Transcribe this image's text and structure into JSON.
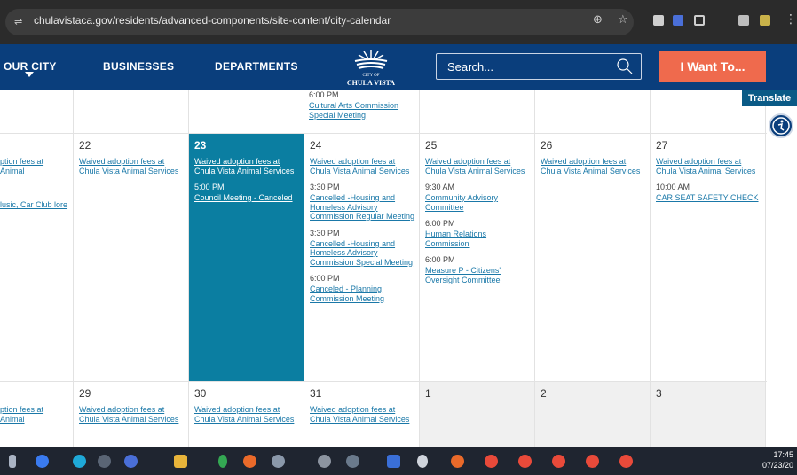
{
  "browser": {
    "url": "chulavistaca.gov/residents/advanced-components/site-content/city-calendar"
  },
  "header": {
    "nav": [
      "OUR CITY",
      "BUSINESSES",
      "DEPARTMENTS"
    ],
    "logo_line1": "CITY OF",
    "logo_line2": "CHULA VISTA",
    "search_placeholder": "Search...",
    "cta": "I Want To..."
  },
  "translate": "Translate",
  "calendar": {
    "prev_row_event": {
      "time": "6:00 PM",
      "title": "Cultural Arts Commission Special Meeting"
    },
    "week1": [
      {
        "day": "",
        "events": [
          {
            "title": "ption fees at Animal"
          },
          {
            "title": "lusic, Car Club lore"
          }
        ]
      },
      {
        "day": "22",
        "events": [
          {
            "title": "Waived adoption fees at Chula Vista Animal Services"
          }
        ]
      },
      {
        "day": "23",
        "events": [
          {
            "title": "Waived adoption fees at Chula Vista Animal Services"
          },
          {
            "time": "5:00 PM",
            "title": "Council Meeting - Canceled"
          }
        ]
      },
      {
        "day": "24",
        "events": [
          {
            "title": "Waived adoption fees at Chula Vista Animal Services"
          },
          {
            "time": "3:30 PM",
            "title": "Cancelled -Housing and Homeless Advisory Commission Regular Meeting"
          },
          {
            "time": "3:30 PM",
            "title": "Cancelled -Housing and Homeless Advisory Commission Special Meeting"
          },
          {
            "time": "6:00 PM",
            "title": "Canceled - Planning Commission Meeting"
          }
        ]
      },
      {
        "day": "25",
        "events": [
          {
            "title": "Waived adoption fees at Chula Vista Animal Services"
          },
          {
            "time": "9:30 AM",
            "title": "Community Advisory Committee"
          },
          {
            "time": "6:00 PM",
            "title": "Human Relations Commission"
          },
          {
            "time": "6:00 PM",
            "title": "Measure P - Citizens' Oversight Committee"
          }
        ]
      },
      {
        "day": "26",
        "events": [
          {
            "title": "Waived adoption fees at Chula Vista Animal Services"
          }
        ]
      },
      {
        "day": "27",
        "events": [
          {
            "title": "Waived adoption fees at Chula Vista Animal Services"
          },
          {
            "time": "10:00 AM",
            "title": "CAR SEAT SAFETY CHECK"
          }
        ]
      }
    ],
    "week2": [
      {
        "day": "",
        "events": [
          {
            "title": "ption fees at Animal"
          }
        ]
      },
      {
        "day": "29",
        "events": [
          {
            "title": "Waived adoption fees at Chula Vista Animal Services"
          }
        ]
      },
      {
        "day": "30",
        "events": [
          {
            "title": "Waived adoption fees at Chula Vista Animal Services"
          }
        ]
      },
      {
        "day": "31",
        "events": [
          {
            "title": "Waived adoption fees at Chula Vista Animal Services"
          }
        ]
      },
      {
        "day": "1",
        "events": []
      },
      {
        "day": "2",
        "events": []
      },
      {
        "day": "3",
        "events": []
      }
    ]
  },
  "taskbar": {
    "time": "17:45",
    "date": "07/23/20"
  },
  "colors": {
    "header_bg": "#0a3e7c",
    "cta_bg": "#ef6a4d",
    "today_bg": "#0b7ea1",
    "link": "#1a78a8"
  }
}
